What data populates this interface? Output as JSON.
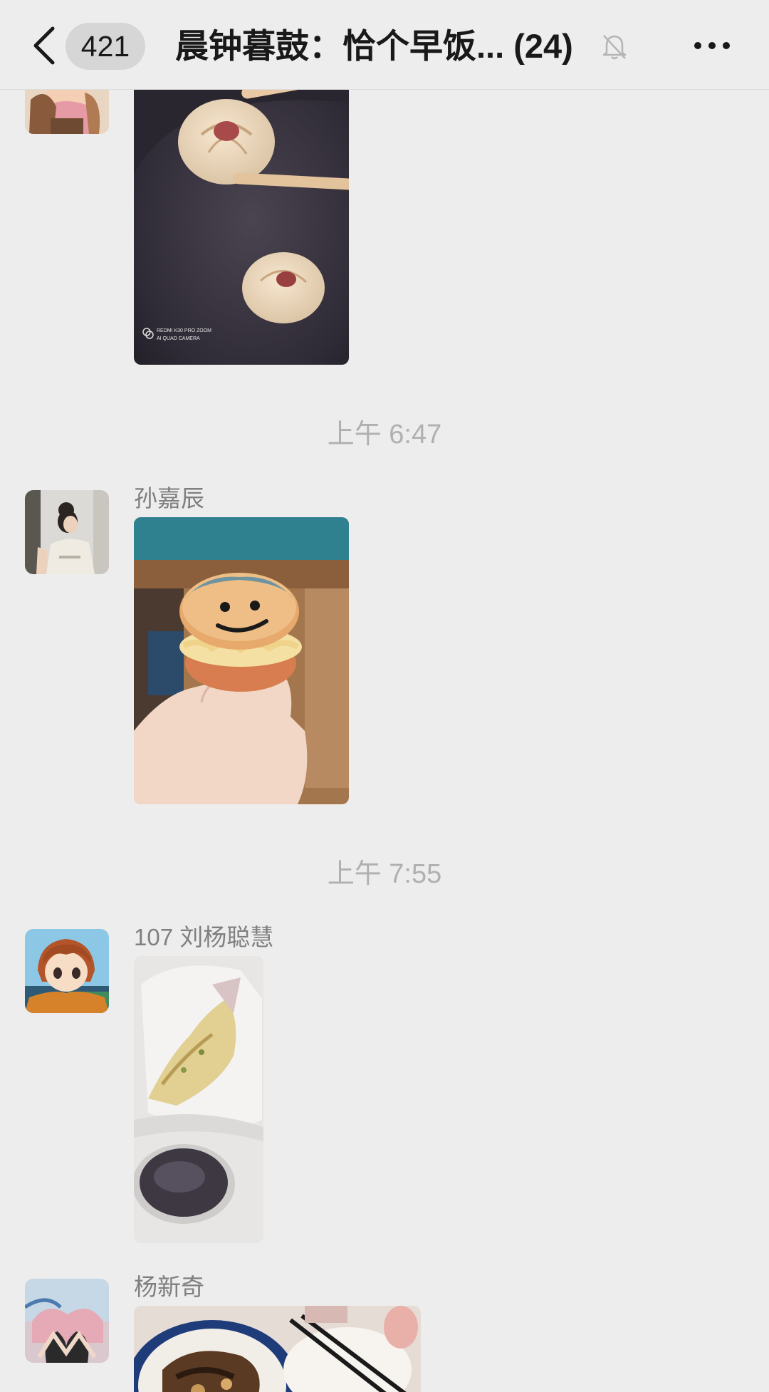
{
  "nav": {
    "back_icon": "chevron-left-icon",
    "unread_count": "421",
    "title": "晨钟暮鼓：恰个早饭... (24)",
    "mute_icon": "bell-slash-icon",
    "more_icon": "ellipsis-icon"
  },
  "messages": [
    {
      "sender": "",
      "photo_subject": "soup dumplings held with chopsticks",
      "watermark_line1": "REDMI K30 PRO ZOOM",
      "watermark_line2": "AI QUAD CAMERA"
    },
    {
      "time": "上午 6:47",
      "sender": "孙嘉辰",
      "photo_subject": "smiley-face sandwich cookie in hand"
    },
    {
      "time": "上午 7:55",
      "sender": "107 刘杨聪慧",
      "photo_subject": "pancake in plastic bag with a cup of black rice porridge"
    },
    {
      "sender": "杨新奇",
      "photo_subject": "plate of fried food with chopsticks and a bowl"
    }
  ],
  "colors": {
    "background": "#ededed",
    "title_text": "#191919",
    "sender_text": "#7f7f7f",
    "timestamp_text": "#b0b0b0",
    "badge_bg": "#d6d6d6"
  }
}
